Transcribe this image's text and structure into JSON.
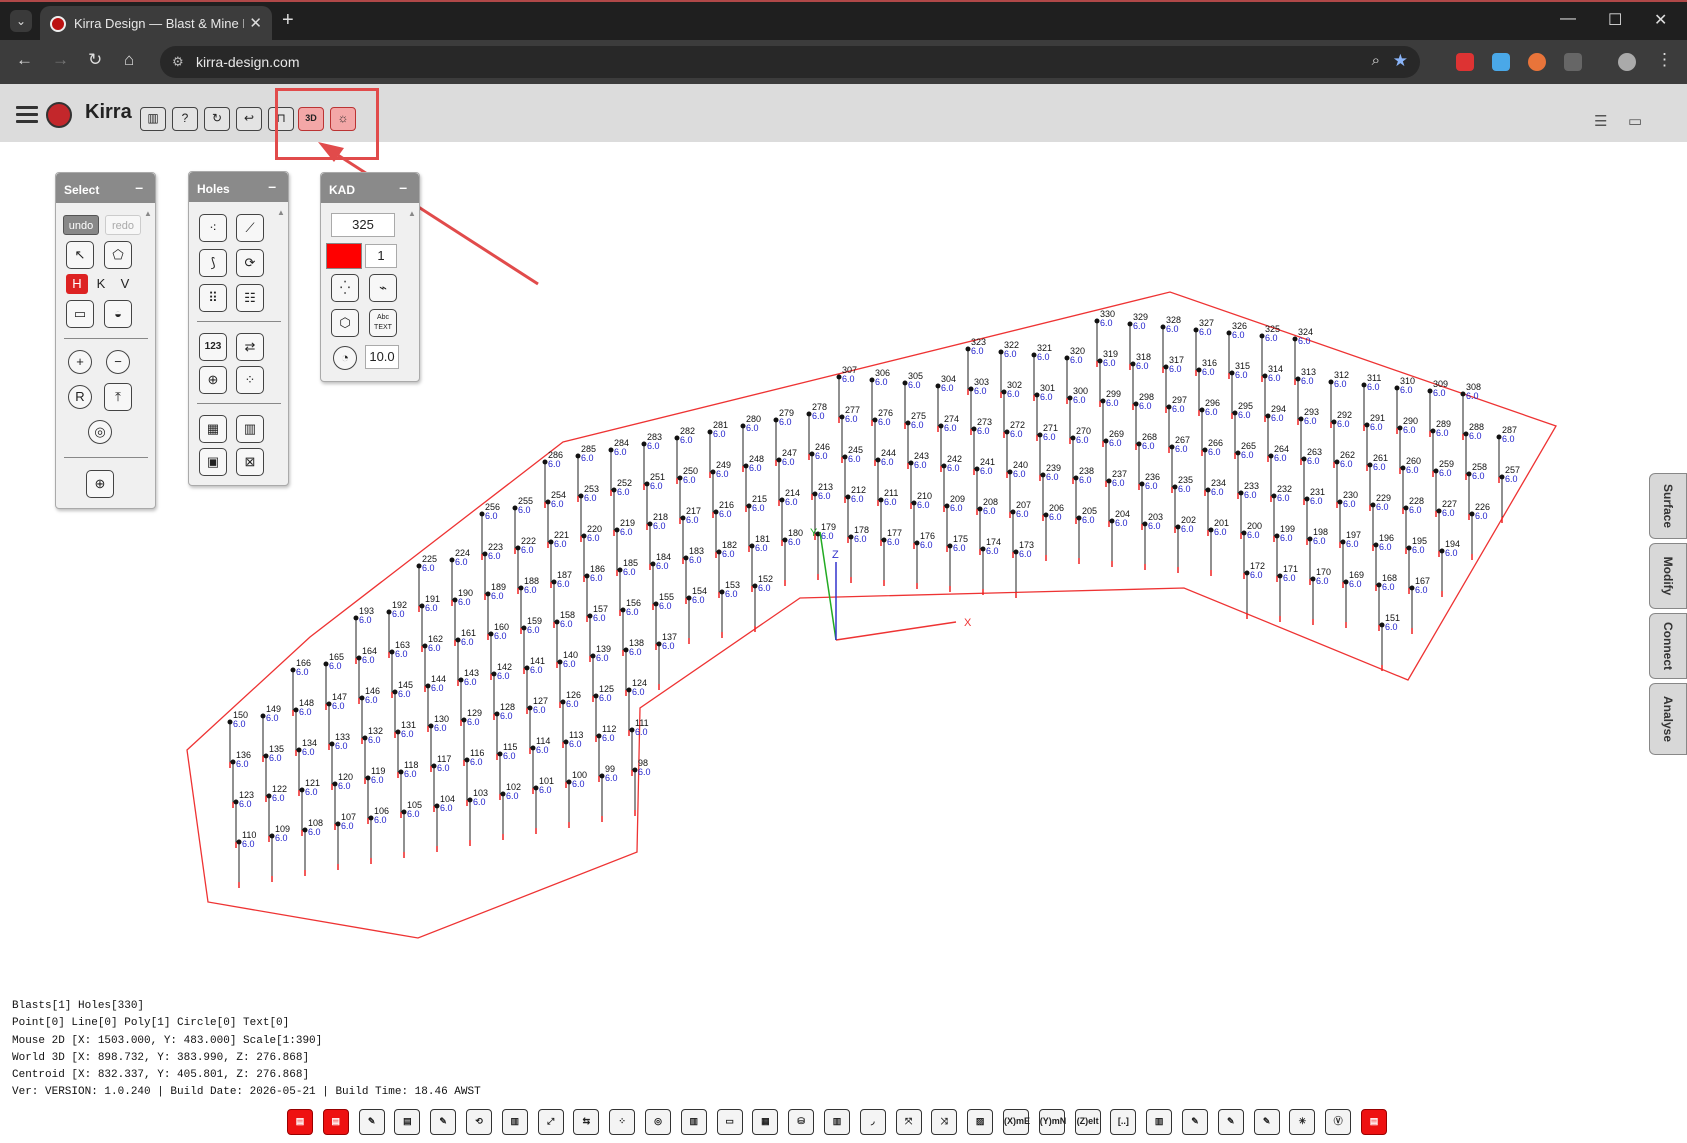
{
  "browser": {
    "tab_title": "Kirra Design — Blast & Mine Design",
    "url": "kirra-design.com",
    "close_tab": "✕",
    "new_tab": "+",
    "win_min": "—",
    "win_max": "☐",
    "win_close": "✕"
  },
  "app": {
    "name": "Kirra",
    "toolbar": [
      {
        "icon": "book-icon",
        "glyph": "▥"
      },
      {
        "icon": "help-icon",
        "glyph": "?"
      },
      {
        "icon": "reload-icon",
        "glyph": "↻"
      },
      {
        "icon": "undo-arrow-icon",
        "glyph": "↩"
      },
      {
        "icon": "2d-view-icon",
        "glyph": "⊓"
      },
      {
        "icon": "3d-view-icon",
        "glyph": "3D"
      },
      {
        "icon": "sun-icon",
        "glyph": "☼"
      }
    ]
  },
  "panels": {
    "select": {
      "title": "Select",
      "undo": "undo",
      "redo": "redo",
      "h": "H",
      "k": "K",
      "v": "V"
    },
    "holes": {
      "title": "Holes",
      "btn_123": "123"
    },
    "kad": {
      "title": "KAD",
      "entity_id": "325",
      "line_width": "1",
      "radius": "10.0",
      "color": "#ff0000",
      "text_btn": "Abc TEXT"
    },
    "minimize": "–"
  },
  "side_tabs": [
    "Surface",
    "Modify",
    "Connect",
    "Analyse"
  ],
  "status": {
    "line1": "Blasts[1] Holes[330]",
    "line2": "Point[0] Line[0] Poly[1] Circle[0] Text[0]",
    "line3": "Mouse 2D [X: 1503.000, Y: 483.000] Scale[1:390]",
    "line4": "World 3D [X: 898.732, Y: 383.990, Z: 276.868]",
    "line5": "Centroid [X: 832.337, Y: 405.801, Z: 276.868]",
    "line6": "Ver: VERSION: 1.0.240 | Build Date: 2026-05-21 | Build Time: 18.46 AWST"
  },
  "axes": {
    "x": "X",
    "y": "Y",
    "z": "Z"
  },
  "hole_value": "6.0",
  "bottom_toolbar": [
    {
      "label": "▤",
      "red": true
    },
    {
      "label": "▤",
      "red": true
    },
    {
      "label": "✎",
      "red": false
    },
    {
      "label": "▤",
      "red": false
    },
    {
      "label": "✎",
      "red": false
    },
    {
      "label": "⟲",
      "red": false
    },
    {
      "label": "▥",
      "red": false
    },
    {
      "label": "⤢",
      "red": false
    },
    {
      "label": "⇆",
      "red": false
    },
    {
      "label": "⁘",
      "red": false
    },
    {
      "label": "◎",
      "red": false
    },
    {
      "label": "▥",
      "red": false
    },
    {
      "label": "▭",
      "red": false
    },
    {
      "label": "▦",
      "red": false
    },
    {
      "label": "⛁",
      "red": false
    },
    {
      "label": "▥",
      "red": false
    },
    {
      "label": "◞",
      "red": false
    },
    {
      "label": "⤧",
      "red": false
    },
    {
      "label": "⤨",
      "red": false
    },
    {
      "label": "▨",
      "red": false
    },
    {
      "label": "(X)mE",
      "red": false
    },
    {
      "label": "(Y)mN",
      "red": false
    },
    {
      "label": "(Z)elt",
      "red": false
    },
    {
      "label": "[..]",
      "red": false
    },
    {
      "label": "▥",
      "red": false
    },
    {
      "label": "✎",
      "red": false
    },
    {
      "label": "✎",
      "red": false
    },
    {
      "label": "✎",
      "red": false
    },
    {
      "label": "✳",
      "red": false
    },
    {
      "label": "Ⓥ",
      "red": false
    },
    {
      "label": "▤",
      "red": true
    }
  ]
}
